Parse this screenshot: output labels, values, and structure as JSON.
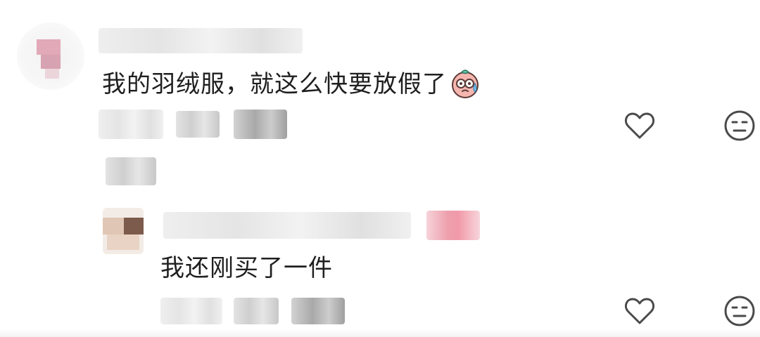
{
  "comment": {
    "text": "我的羽绒服，就这么快要放假了",
    "emoji_name": "sweat-smile-face-icon",
    "actions": {
      "like_icon": "heart-outline-icon",
      "dislike_icon": "neutral-face-icon"
    }
  },
  "reply": {
    "text": "我还刚买了一件",
    "actions": {
      "like_icon": "heart-outline-icon",
      "dislike_icon": "neutral-face-icon"
    }
  },
  "colors": {
    "text": "#1f1f1f",
    "icon_stroke": "#4a4a4a",
    "author_badge": "#ee9fad"
  }
}
